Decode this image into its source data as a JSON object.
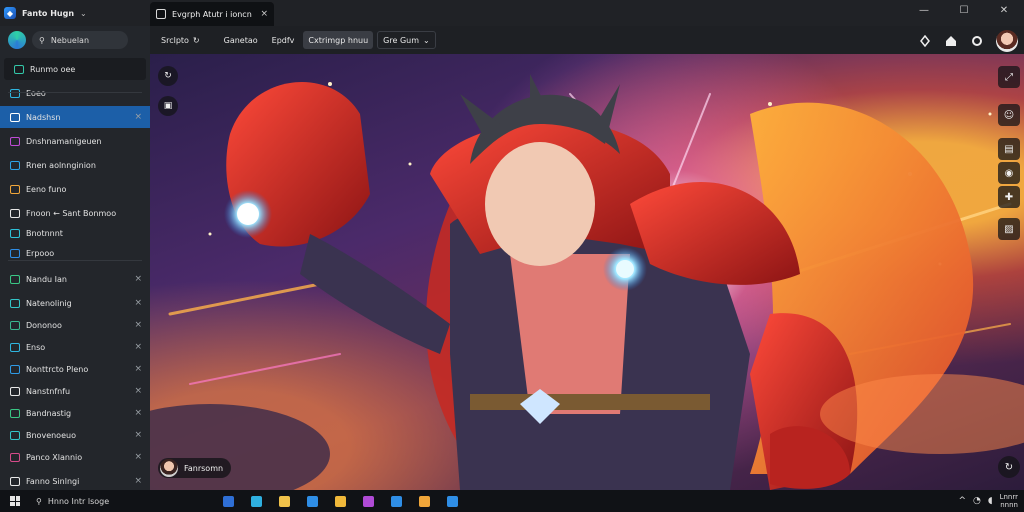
{
  "app": {
    "title": "Fanto Hugn",
    "logo_icon": "shield-logo-icon",
    "menu_chevron": "⌄"
  },
  "tab": {
    "label": "Evgrph Atutr i ioncn",
    "close": "×"
  },
  "window": {
    "minimize": "—",
    "maximize": "☐",
    "close": "✕"
  },
  "toolbar": {
    "items": [
      {
        "label": "Srclpto",
        "icon": "↻"
      },
      {
        "label": "Ganetao"
      },
      {
        "label": "Epdfv"
      },
      {
        "label": "Cxtrimgp hnuu"
      },
      {
        "label": "Gre Gum",
        "icon": "⌄"
      }
    ],
    "right_icons": [
      "bell-icon",
      "home-icon",
      "settings-icon"
    ]
  },
  "sidebar": {
    "search_placeholder": "Nebuelan",
    "items": [
      {
        "label": "Runmo oee",
        "color": "#33c7a8",
        "closable": false
      },
      {
        "label": "Eoeo",
        "color": "#2fb6e0",
        "closable": false
      },
      {
        "label": "Nadshsn",
        "color": "#ffffff",
        "closable": true,
        "selected": true
      },
      {
        "label": "Dnshnamanigeuen",
        "color": "#c04bd6",
        "closable": false
      },
      {
        "label": "Rnen aolnnginion",
        "color": "#2ea3e6",
        "closable": false
      },
      {
        "label": "Eeno funo",
        "color": "#f0a63a",
        "closable": false
      },
      {
        "label": "Fnoon ← Sant Bonmoo",
        "color": "#e8e8e8",
        "closable": false
      },
      {
        "label": "Bnotnnnt",
        "color": "#2fc2d9",
        "closable": false
      },
      {
        "label": "Erpooo",
        "color": "#2f8ee6",
        "closable": false
      },
      {
        "label": "Nandu Ian",
        "color": "#3ac785",
        "closable": true
      },
      {
        "label": "Natenolinig",
        "color": "#34c6c9",
        "closable": true
      },
      {
        "label": "Dononoo",
        "color": "#3ab890",
        "closable": true
      },
      {
        "label": "Enso",
        "color": "#2fb6e0",
        "closable": true
      },
      {
        "label": "Nonttrcto Pleno",
        "color": "#2f9be6",
        "closable": true
      },
      {
        "label": "Nanstnfnfu",
        "color": "#e8e8e8",
        "closable": true
      },
      {
        "label": "Bandnastig",
        "color": "#3ac785",
        "closable": true
      },
      {
        "label": "Bnovenoeuo",
        "color": "#34c6c9",
        "closable": true
      },
      {
        "label": "Panco Xlannio",
        "color": "#d64b8a",
        "closable": true
      },
      {
        "label": "Fanno Sinlngi",
        "color": "#e8e8e8",
        "closable": true
      }
    ]
  },
  "viewport": {
    "left_controls": [
      "refresh-icon",
      "layout-icon"
    ],
    "side_controls": [
      "expand-icon",
      "user-icon",
      "page-icon",
      "globe-icon",
      "tools-icon",
      "image-icon"
    ],
    "creator": "Fanrsomn"
  },
  "taskbar": {
    "search_placeholder": "Hnno Intr lsoge",
    "apps": [
      {
        "name": "file-explorer-icon",
        "color": "#2f6fd6"
      },
      {
        "name": "edge-icon",
        "color": "#2fb0e0"
      },
      {
        "name": "folder-icon",
        "color": "#f0c24a"
      },
      {
        "name": "store-icon",
        "color": "#2f8ee6"
      },
      {
        "name": "app-icon",
        "color": "#f0b83a"
      },
      {
        "name": "media-icon",
        "color": "#b04bd6"
      },
      {
        "name": "photos-icon",
        "color": "#2f8ee6"
      },
      {
        "name": "gallery-icon",
        "color": "#f0a63a"
      },
      {
        "name": "settings-icon",
        "color": "#2f8ee6"
      }
    ],
    "tray": {
      "chevron": "^",
      "time": "Lnnrr",
      "date": "nnnn"
    }
  }
}
